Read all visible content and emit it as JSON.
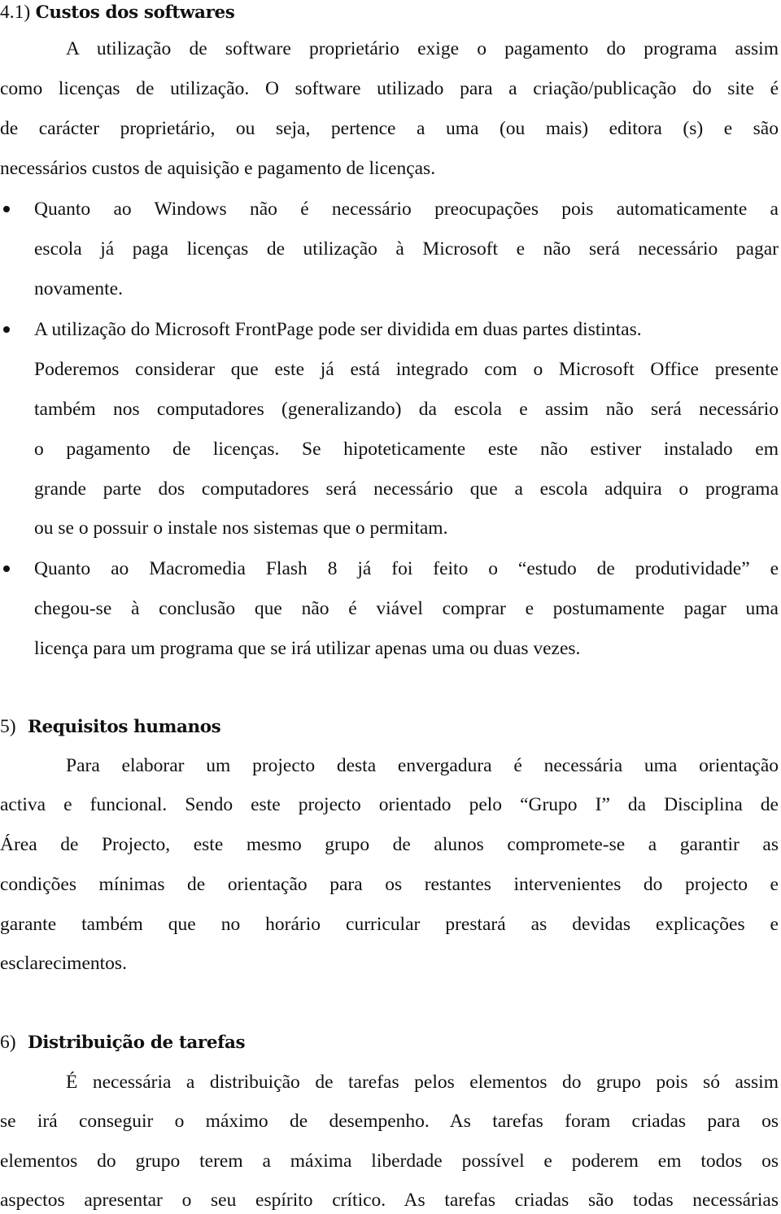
{
  "section_4_1": {
    "number": "4.1)",
    "title": "Custos dos softwares",
    "intro_lines": [
      "A utilização de software proprietário exige o pagamento do programa assim",
      "como licenças de utilização. O software utilizado para a criação/publicação do site é",
      "de carácter proprietário, ou seja, pertence a uma (ou mais) editora (s) e são",
      "necessários custos de aquisição e pagamento de licenças."
    ],
    "bullets": [
      {
        "lines": [
          "Quanto ao Windows não é necessário preocupações pois automaticamente a",
          "escola já paga licenças de utilização à Microsoft e não será necessário pagar",
          "novamente."
        ]
      },
      {
        "lines": [
          "A utilização do Microsoft FrontPage pode ser dividida em duas partes distintas.",
          "Poderemos considerar que este já está integrado com o Microsoft Office presente",
          "também nos computadores (generalizando) da escola e assim não será necessário",
          "o pagamento de licenças. Se hipoteticamente este não estiver instalado em",
          "grande parte dos computadores será necessário que a escola adquira o programa",
          "ou se o possuir o instale nos sistemas que o permitam."
        ]
      },
      {
        "lines": [
          "Quanto ao Macromedia Flash 8 já foi feito o “estudo de produtividade” e",
          "chegou-se à conclusão que não é viável comprar e postumamente pagar uma",
          "licença para um programa que se irá utilizar apenas uma ou duas vezes."
        ]
      }
    ]
  },
  "section_5": {
    "number": "5)",
    "title": "Requisitos humanos",
    "lines": [
      "Para elaborar um projecto desta envergadura é necessária uma orientação",
      "activa e funcional. Sendo este projecto orientado pelo “Grupo I” da Disciplina de",
      "Área de Projecto, este mesmo grupo de alunos compromete-se a garantir as",
      "condições mínimas de orientação para os restantes intervenientes do projecto e",
      "garante também que no horário curricular prestará as devidas explicações e",
      "esclarecimentos."
    ]
  },
  "section_6": {
    "number": "6)",
    "title": "Distribuição de tarefas",
    "lines": [
      "É necessária a distribuição de tarefas pelos elementos do grupo pois só assim",
      "se irá conseguir o máximo de desempenho. As tarefas foram criadas para os",
      "elementos do grupo terem a máxima liberdade possível e poderem em todos os",
      "aspectos apresentar o seu espírito crítico. As tarefas criadas são todas necessárias"
    ]
  }
}
